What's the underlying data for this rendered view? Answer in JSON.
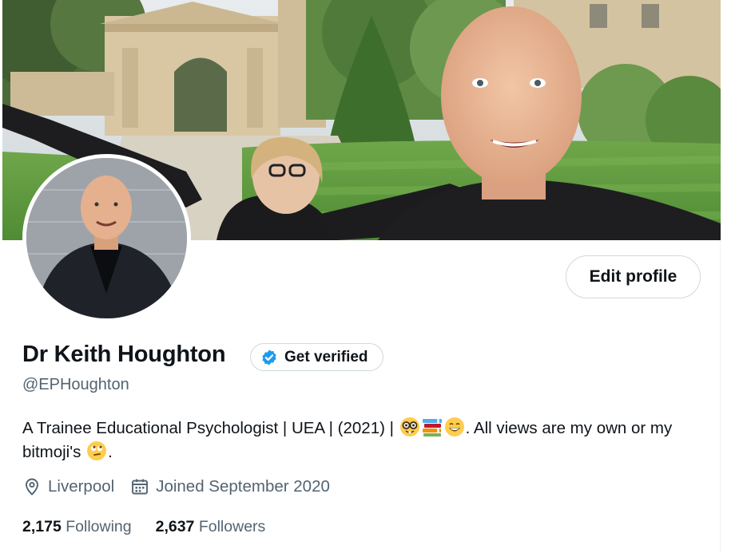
{
  "profile": {
    "name": "Dr Keith Houghton",
    "handle": "@EPHoughton",
    "verify_label": "Get verified",
    "edit_label": "Edit profile",
    "bio_text_1": "A Trainee Educational Psychologist | UEA | (2021) | ",
    "bio_text_2": ". All views are my own or my bitmoji's ",
    "bio_text_3": ".",
    "bio_emojis": [
      "nerd-face-emoji",
      "books-emoji",
      "grinning-face-emoji",
      "face-with-rolling-eyes-emoji"
    ],
    "location": "Liverpool",
    "joined": "Joined September 2020",
    "following_count": "2,175",
    "following_label": "Following",
    "followers_count": "2,637",
    "followers_label": "Followers"
  },
  "icons": {
    "verify_badge": "verified-badge-icon",
    "location": "location-pin-icon",
    "calendar": "calendar-icon"
  },
  "colors": {
    "accent": "#1d9bf0",
    "text": "#0f1419",
    "muted": "#536471",
    "border": "#cfd9de"
  }
}
